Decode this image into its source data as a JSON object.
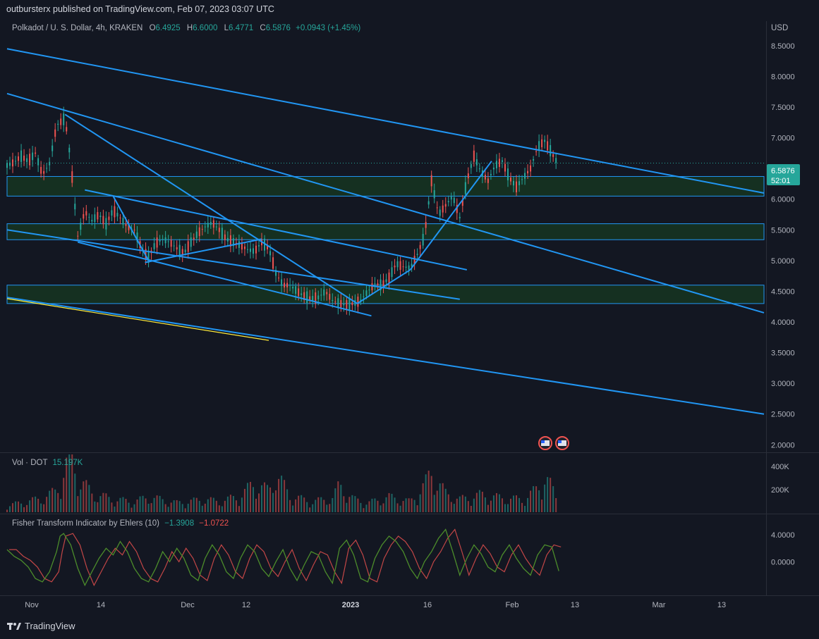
{
  "header": {
    "publisher_line": "outbursterx published on TradingView.com, Feb 07, 2023 03:07 UTC",
    "symbol": "Polkadot / U. S. Dollar, 4h, KRAKEN",
    "open_label": "O",
    "open": "6.4925",
    "high_label": "H",
    "high": "6.6000",
    "low_label": "L",
    "low": "6.4771",
    "close_label": "C",
    "close": "6.5876",
    "change": "+0.0943 (+1.45%)",
    "currency": "USD"
  },
  "price_badge": {
    "price": "6.5876",
    "countdown": "52:01"
  },
  "volume_pane": {
    "label": "Vol · DOT",
    "value": "15.197K",
    "ticks": [
      "400K",
      "200K"
    ]
  },
  "fisher_pane": {
    "label": "Fisher Transform Indicator by Ehlers (10)",
    "fisher": "−1.3908",
    "trigger": "−1.0722",
    "ticks": [
      "4.0000",
      "0.0000"
    ]
  },
  "brand": {
    "name": "TradingView"
  },
  "colors": {
    "bg": "#131722",
    "up": "#26a69a",
    "down": "#ef5350",
    "line": "#2196f3",
    "zone": "#1b5e20"
  },
  "chart_data": {
    "type": "line",
    "title": "Polkadot / U. S. Dollar, 4h, KRAKEN",
    "y_ticks": [
      "8.5000",
      "8.0000",
      "7.5000",
      "7.0000",
      "6.5000",
      "6.0000",
      "5.5000",
      "5.0000",
      "4.5000",
      "4.0000",
      "3.5000",
      "3.0000",
      "2.5000",
      "2.0000"
    ],
    "x_ticks": [
      "Nov",
      "14",
      "Dec",
      "12",
      "2023",
      "16",
      "Feb",
      "13",
      "Mar",
      "13"
    ],
    "ylim": [
      1.9,
      8.9
    ],
    "xlim": [
      0,
      107
    ],
    "zones": [
      [
        6.05,
        6.37
      ],
      [
        5.34,
        5.6
      ],
      [
        4.3,
        4.6
      ]
    ],
    "trendlines": [
      {
        "x1": 0,
        "y1": 8.45,
        "x2": 107,
        "y2": 6.1
      },
      {
        "x1": 0,
        "y1": 7.72,
        "x2": 107,
        "y2": 4.15
      },
      {
        "x1": 0,
        "y1": 5.5,
        "x2": 64,
        "y2": 4.37
      },
      {
        "x1": 0,
        "y1": 4.4,
        "x2": 107,
        "y2": 2.5
      },
      {
        "x1": 8.2,
        "y1": 7.38,
        "x2": 49.5,
        "y2": 4.3
      },
      {
        "x1": 11,
        "y1": 6.15,
        "x2": 65,
        "y2": 4.85
      },
      {
        "x1": 10,
        "y1": 5.3,
        "x2": 51.5,
        "y2": 4.1
      },
      {
        "x1": 19.5,
        "y1": 4.97,
        "x2": 36,
        "y2": 5.35
      },
      {
        "x1": 15,
        "y1": 6.05,
        "x2": 20,
        "y2": 5.0
      },
      {
        "x1": 49.5,
        "y1": 4.3,
        "x2": 57,
        "y2": 4.85
      },
      {
        "x1": 57,
        "y1": 4.85,
        "x2": 68.5,
        "y2": 6.62
      }
    ],
    "highlight_line": {
      "x1": 0,
      "y1": 4.38,
      "x2": 37,
      "y2": 3.7
    },
    "price_path": [
      [
        0,
        6.55
      ],
      [
        1,
        6.6
      ],
      [
        2,
        6.7
      ],
      [
        3,
        6.62
      ],
      [
        4,
        6.75
      ],
      [
        5,
        6.4
      ],
      [
        6,
        6.58
      ],
      [
        7,
        7.2
      ],
      [
        8,
        7.3
      ],
      [
        8.5,
        7.1
      ],
      [
        9,
        6.6
      ],
      [
        10,
        5.4
      ],
      [
        11,
        5.8
      ],
      [
        12,
        5.65
      ],
      [
        13,
        5.75
      ],
      [
        14,
        5.6
      ],
      [
        15,
        5.82
      ],
      [
        16,
        5.7
      ],
      [
        17,
        5.55
      ],
      [
        18,
        5.5
      ],
      [
        19,
        5.2
      ],
      [
        20,
        5.05
      ],
      [
        21,
        5.28
      ],
      [
        22,
        5.35
      ],
      [
        23,
        5.3
      ],
      [
        24,
        5.2
      ],
      [
        25,
        5.12
      ],
      [
        26,
        5.3
      ],
      [
        27,
        5.45
      ],
      [
        28,
        5.55
      ],
      [
        29,
        5.62
      ],
      [
        30,
        5.5
      ],
      [
        31,
        5.35
      ],
      [
        32,
        5.3
      ],
      [
        33,
        5.25
      ],
      [
        34,
        5.18
      ],
      [
        35,
        5.15
      ],
      [
        36,
        5.3
      ],
      [
        37,
        5.2
      ],
      [
        38,
        4.8
      ],
      [
        39,
        4.6
      ],
      [
        40,
        4.6
      ],
      [
        41,
        4.5
      ],
      [
        42,
        4.42
      ],
      [
        43,
        4.38
      ],
      [
        44,
        4.4
      ],
      [
        45,
        4.5
      ],
      [
        46,
        4.35
      ],
      [
        47,
        4.3
      ],
      [
        48,
        4.28
      ],
      [
        49,
        4.3
      ],
      [
        50,
        4.35
      ],
      [
        51,
        4.5
      ],
      [
        52,
        4.62
      ],
      [
        53,
        4.6
      ],
      [
        54,
        4.72
      ],
      [
        55,
        4.95
      ],
      [
        56,
        4.9
      ],
      [
        57,
        4.88
      ],
      [
        58,
        5.1
      ],
      [
        59,
        5.4
      ],
      [
        60,
        6.3
      ],
      [
        61,
        5.75
      ],
      [
        62,
        5.9
      ],
      [
        63,
        6.05
      ],
      [
        64,
        5.7
      ],
      [
        65,
        6.3
      ],
      [
        66,
        6.7
      ],
      [
        67,
        6.45
      ],
      [
        68,
        6.3
      ],
      [
        69,
        6.55
      ],
      [
        70,
        6.62
      ],
      [
        71,
        6.35
      ],
      [
        72,
        6.2
      ],
      [
        73,
        6.35
      ],
      [
        74,
        6.5
      ],
      [
        75,
        6.85
      ],
      [
        76,
        6.95
      ],
      [
        77,
        6.75
      ],
      [
        78,
        6.55
      ]
    ],
    "volume_path": [
      [
        0,
        60
      ],
      [
        2,
        80
      ],
      [
        5,
        120
      ],
      [
        7,
        180
      ],
      [
        8,
        350
      ],
      [
        9,
        480
      ],
      [
        10,
        300
      ],
      [
        12,
        160
      ],
      [
        15,
        110
      ],
      [
        18,
        90
      ],
      [
        20,
        130
      ],
      [
        24,
        80
      ],
      [
        28,
        110
      ],
      [
        30,
        90
      ],
      [
        33,
        140
      ],
      [
        35,
        250
      ],
      [
        37,
        180
      ],
      [
        38,
        330
      ],
      [
        40,
        140
      ],
      [
        43,
        90
      ],
      [
        46,
        120
      ],
      [
        47,
        230
      ],
      [
        49,
        110
      ],
      [
        51,
        80
      ],
      [
        54,
        130
      ],
      [
        57,
        90
      ],
      [
        59,
        230
      ],
      [
        60,
        340
      ],
      [
        62,
        160
      ],
      [
        64,
        110
      ],
      [
        67,
        150
      ],
      [
        70,
        120
      ],
      [
        73,
        110
      ],
      [
        75,
        200
      ],
      [
        76,
        310
      ],
      [
        77,
        210
      ],
      [
        78,
        70
      ]
    ],
    "fisher_path": [
      [
        0,
        1.8
      ],
      [
        1,
        0.8
      ],
      [
        2,
        0.2
      ],
      [
        3,
        -0.8
      ],
      [
        4,
        -2.5
      ],
      [
        5,
        -3.0
      ],
      [
        6,
        -1.5
      ],
      [
        7,
        1.5
      ],
      [
        7.5,
        3.8
      ],
      [
        8,
        4.2
      ],
      [
        9,
        2.5
      ],
      [
        10,
        -1.0
      ],
      [
        11,
        -3.5
      ],
      [
        12,
        -1.5
      ],
      [
        13,
        0.5
      ],
      [
        14,
        2.0
      ],
      [
        15,
        1.0
      ],
      [
        16,
        3.0
      ],
      [
        17,
        1.5
      ],
      [
        18,
        -1.0
      ],
      [
        19,
        -2.5
      ],
      [
        20,
        -3.0
      ],
      [
        21,
        -1.0
      ],
      [
        22,
        1.5
      ],
      [
        23,
        0.0
      ],
      [
        24,
        2.0
      ],
      [
        25,
        0.5
      ],
      [
        26,
        -2.0
      ],
      [
        27,
        -2.8
      ],
      [
        28,
        0.5
      ],
      [
        29,
        2.5
      ],
      [
        30,
        1.0
      ],
      [
        31,
        -1.5
      ],
      [
        32,
        -2.5
      ],
      [
        33,
        0.5
      ],
      [
        34,
        2.5
      ],
      [
        35,
        1.5
      ],
      [
        36,
        -1.0
      ],
      [
        37,
        -2.2
      ],
      [
        38,
        0.0
      ],
      [
        39,
        1.8
      ],
      [
        40,
        -1.0
      ],
      [
        41,
        -2.8
      ],
      [
        42,
        -0.5
      ],
      [
        43,
        1.5
      ],
      [
        44,
        1.0
      ],
      [
        45,
        -1.5
      ],
      [
        46,
        -3.2
      ],
      [
        47,
        2.0
      ],
      [
        48,
        3.2
      ],
      [
        49,
        1.0
      ],
      [
        50,
        -2.5
      ],
      [
        51,
        -3.0
      ],
      [
        52,
        0.5
      ],
      [
        53,
        2.5
      ],
      [
        54,
        3.8
      ],
      [
        55,
        3.0
      ],
      [
        56,
        1.5
      ],
      [
        57,
        -1.0
      ],
      [
        58,
        -2.5
      ],
      [
        59,
        0.0
      ],
      [
        60,
        1.5
      ],
      [
        61,
        3.5
      ],
      [
        62,
        4.8
      ],
      [
        63,
        1.5
      ],
      [
        64,
        -2.0
      ],
      [
        65,
        0.5
      ],
      [
        66,
        2.5
      ],
      [
        67,
        1.2
      ],
      [
        68,
        -0.8
      ],
      [
        69,
        -1.5
      ],
      [
        70,
        1.0
      ],
      [
        71,
        2.5
      ],
      [
        72,
        0.5
      ],
      [
        73,
        -1.0
      ],
      [
        74,
        -2.0
      ],
      [
        75,
        1.0
      ],
      [
        76,
        2.5
      ],
      [
        77,
        2.2
      ],
      [
        78,
        -1.4
      ]
    ]
  }
}
